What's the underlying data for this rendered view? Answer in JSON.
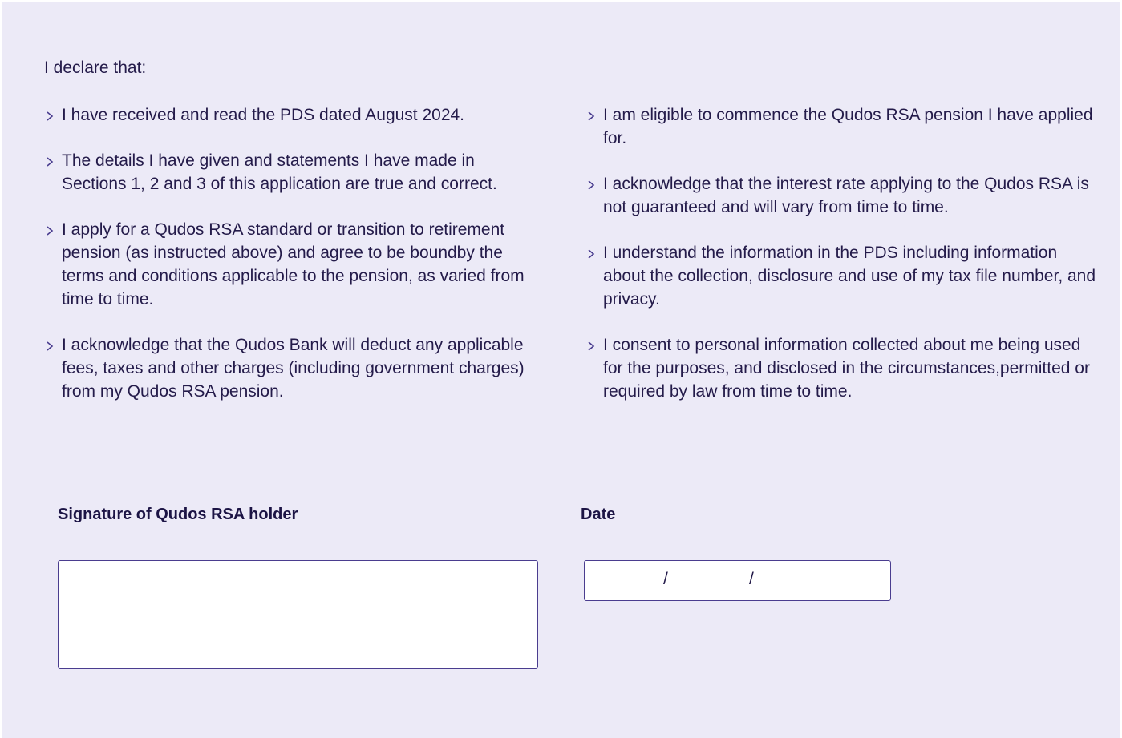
{
  "intro": "I declare that:",
  "left_items": [
    "I have received and read the PDS dated August 2024.",
    "The details I have given and statements I have made in Sections 1, 2 and 3 of this application are true and correct.",
    "I apply for a Qudos RSA standard or transition to retirement pension (as instructed above) and agree to be boundby the terms and conditions applicable to the pension, as varied from time to time.",
    "I acknowledge that the Qudos Bank will deduct any applicable fees, taxes and other charges (including government charges) from my Qudos RSA pension."
  ],
  "right_items": [
    "I am eligible to commence the Qudos RSA pension I have applied for.",
    "I acknowledge that the interest rate applying to the Qudos RSA is not guaranteed and will vary from time to time.",
    "I understand the information in the PDS including information about the collection, disclosure and use of my tax file number, and privacy.",
    "I consent to personal information collected about me being used for the purposes, and disclosed in the circumstances,permitted or required by law from time to time."
  ],
  "signature_label": "Signature of Qudos RSA holder",
  "date_label": "Date",
  "date_separator": "/",
  "colors": {
    "background": "#eceaf7",
    "text": "#241b4a",
    "border": "#4a3d8f"
  },
  "icons": {
    "bullet": "chevron-right-icon"
  }
}
